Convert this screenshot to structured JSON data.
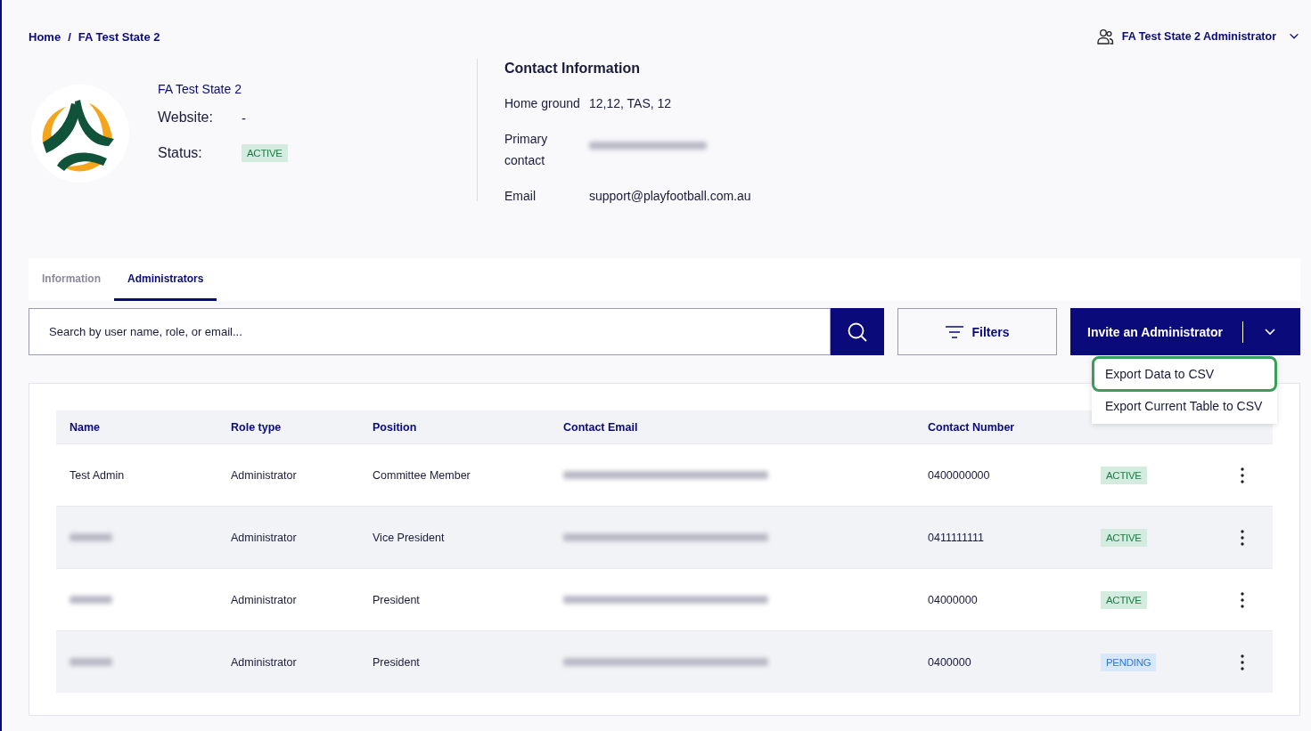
{
  "breadcrumb": [
    "Home",
    "FA Test State 2"
  ],
  "breadcrumb_separator": "/",
  "user_menu": {
    "label": "FA Test State 2 Administrator"
  },
  "organisation": {
    "name": "FA Test State 2",
    "website_label": "Website:",
    "website": "-",
    "status_label": "Status:",
    "status": {
      "kind": "active",
      "text": "ACTIVE"
    }
  },
  "contact": {
    "title": "Contact Information",
    "fields": [
      {
        "label": "Home ground",
        "value": {
          "kind": "text",
          "text": "12,12, TAS, 12"
        }
      },
      {
        "label": "Primary contact",
        "value": {
          "kind": "redacted"
        }
      },
      {
        "label": "Email",
        "value": {
          "kind": "text",
          "text": "support@playfootball.com.au"
        }
      }
    ]
  },
  "tabs": [
    {
      "label": "Information",
      "selected": false
    },
    {
      "label": "Administrators",
      "selected": true
    }
  ],
  "search": {
    "placeholder": "Search by user name, role, or email..."
  },
  "filters_button": "Filters",
  "invite_button": "Invite an Administrator",
  "dropdown": [
    {
      "label": "Export Data to CSV",
      "selected": true
    },
    {
      "label": "Export Current Table to CSV",
      "selected": false
    }
  ],
  "table": {
    "columns": [
      "Name",
      "Role type",
      "Position",
      "Contact Email",
      "Contact Number"
    ],
    "rows": [
      {
        "name": {
          "kind": "text",
          "text": "Test Admin"
        },
        "role": "Administrator",
        "position": "Committee Member",
        "email": {
          "kind": "redacted"
        },
        "number": "0400000000",
        "status": {
          "kind": "active",
          "text": "ACTIVE"
        }
      },
      {
        "name": {
          "kind": "redacted"
        },
        "role": "Administrator",
        "position": "Vice President",
        "email": {
          "kind": "redacted"
        },
        "number": "0411111111",
        "status": {
          "kind": "active",
          "text": "ACTIVE"
        }
      },
      {
        "name": {
          "kind": "redacted"
        },
        "role": "Administrator",
        "position": "President",
        "email": {
          "kind": "redacted"
        },
        "number": "04000000",
        "status": {
          "kind": "active",
          "text": "ACTIVE"
        }
      },
      {
        "name": {
          "kind": "redacted"
        },
        "role": "Administrator",
        "position": "President",
        "email": {
          "kind": "redacted"
        },
        "number": "0400000",
        "status": {
          "kind": "pending",
          "text": "PENDING"
        }
      }
    ]
  }
}
